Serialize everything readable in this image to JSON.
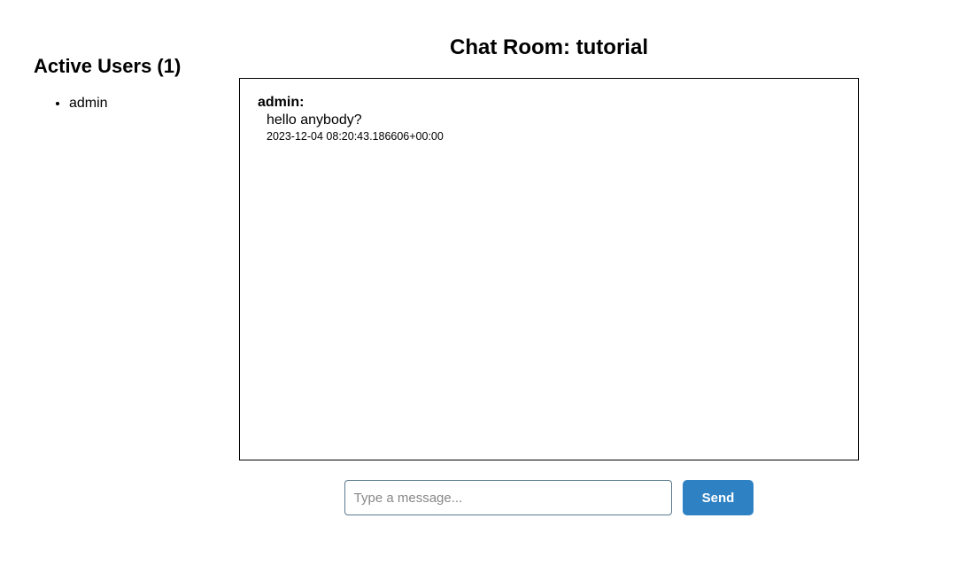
{
  "sidebar": {
    "title": "Active Users (1)",
    "users": [
      {
        "name": "admin"
      }
    ]
  },
  "main": {
    "room_title": "Chat Room: tutorial",
    "messages": [
      {
        "author": "admin:",
        "text": "hello anybody?",
        "timestamp": "2023-12-04 08:20:43.186606+00:00"
      }
    ],
    "composer": {
      "placeholder": "Type a message...",
      "value": "",
      "send_label": "Send"
    }
  }
}
